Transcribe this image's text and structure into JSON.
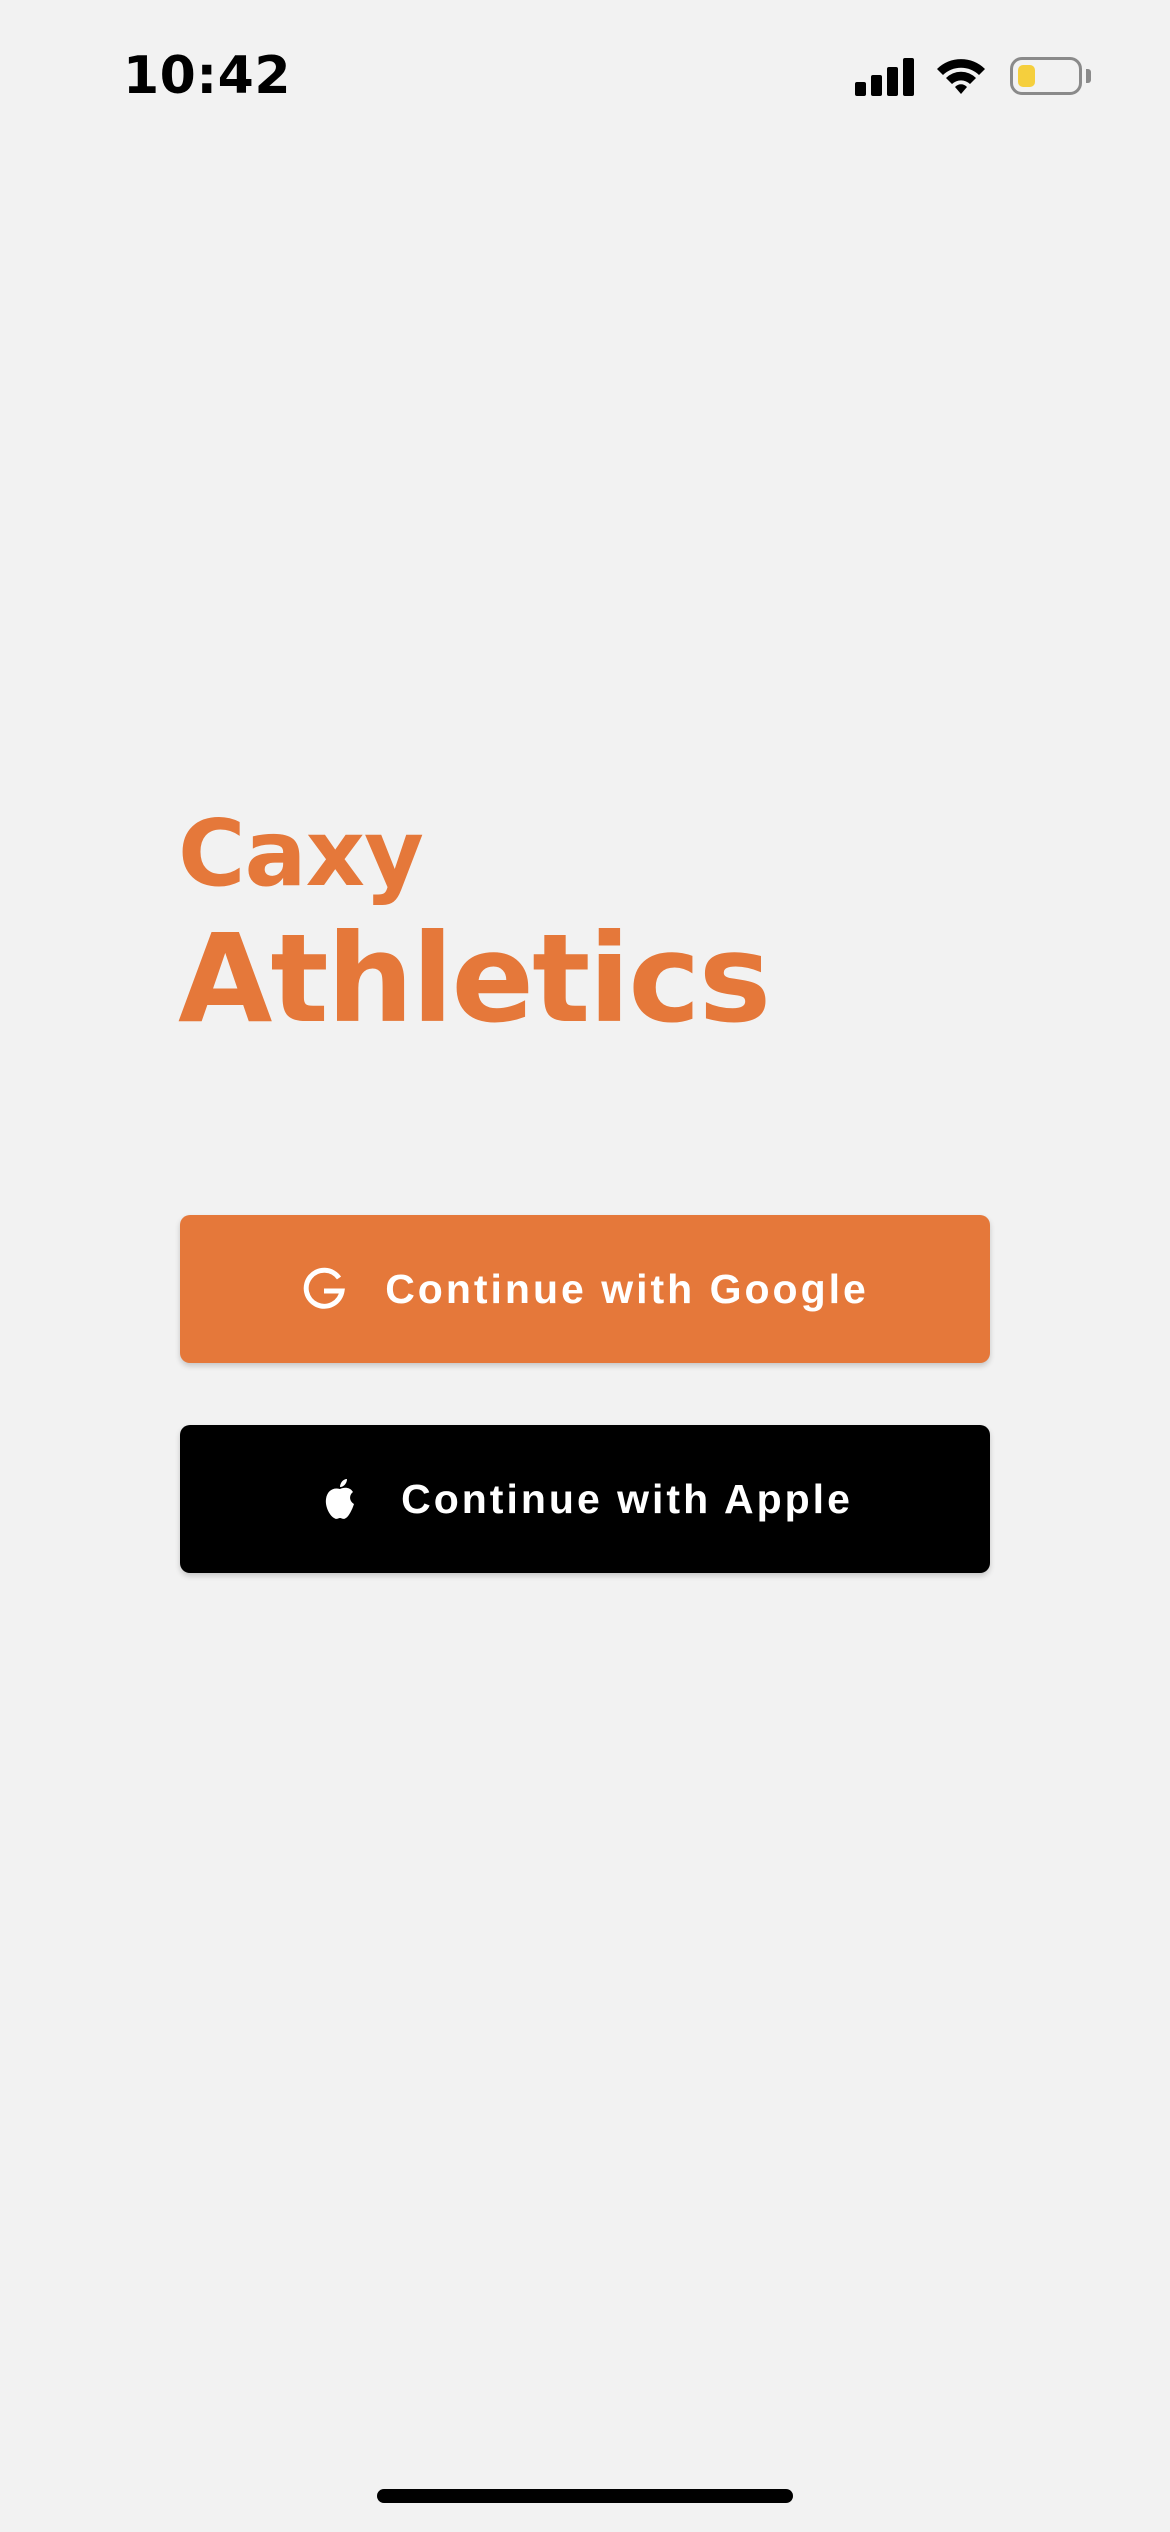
{
  "status_bar": {
    "time": "10:42",
    "battery_level": 0.3,
    "battery_color": "#f5cf3d"
  },
  "brand": {
    "line1": "Caxy",
    "line2": "Athletics",
    "color": "#e5783a"
  },
  "buttons": {
    "google": {
      "label": "Continue with Google",
      "icon": "google-g-icon",
      "background": "#e5783a"
    },
    "apple": {
      "label": "Continue with Apple",
      "icon": "apple-icon",
      "background": "#000000"
    }
  }
}
